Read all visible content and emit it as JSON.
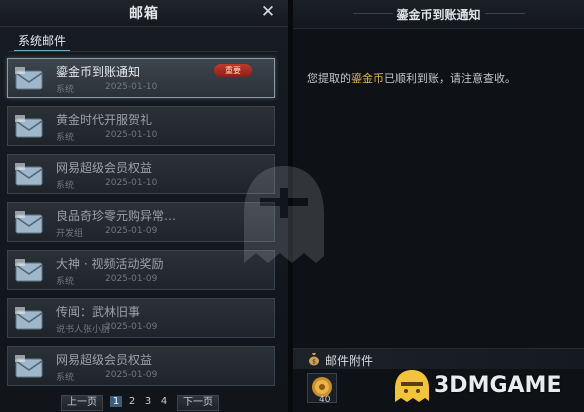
{
  "mailbox": {
    "title": "邮箱",
    "close_glyph": "✕",
    "tab_label": "系统邮件"
  },
  "mails": [
    {
      "subject": "鎏金币到账通知",
      "sender": "系统",
      "date": "2025-01-10",
      "badge": "重要",
      "selected": true
    },
    {
      "subject": "黄金时代开服贺礼",
      "sender": "系统",
      "date": "2025-01-10",
      "badge": "",
      "selected": false
    },
    {
      "subject": "网易超级会员权益",
      "sender": "系统",
      "date": "2025-01-10",
      "badge": "",
      "selected": false
    },
    {
      "subject": "良品奇珍零元购异常…",
      "sender": "开发组",
      "date": "2025-01-09",
      "badge": "",
      "selected": false
    },
    {
      "subject": "大神 · 视频活动奖励",
      "sender": "系统",
      "date": "2025-01-09",
      "badge": "",
      "selected": false
    },
    {
      "subject": "传闻：武林旧事",
      "sender": "说书人张小厨",
      "date": "2025-01-09",
      "badge": "",
      "selected": false
    },
    {
      "subject": "网易超级会员权益",
      "sender": "系统",
      "date": "2025-01-09",
      "badge": "",
      "selected": false
    }
  ],
  "pager": {
    "prev_label": "上一页",
    "next_label": "下一页",
    "pages": [
      "1",
      "2",
      "3",
      "4"
    ],
    "current": "1"
  },
  "detail": {
    "title": "鎏金币到账通知",
    "body_before": "您提取的",
    "body_highlight": "鎏金币",
    "body_after": "已顺利到账，请注意查收。",
    "attachments_title": "邮件附件",
    "attachment_count": "40"
  },
  "watermark": {
    "text": "3DMGAME"
  },
  "icons": {
    "mail": "envelope-icon",
    "close": "close-icon",
    "attachment": "money-bag-icon",
    "coin": "gold-coin-icon"
  },
  "colors": {
    "highlight": "#d9b25c",
    "badge": "#c0392b",
    "active_page": "#3b5d7c"
  }
}
